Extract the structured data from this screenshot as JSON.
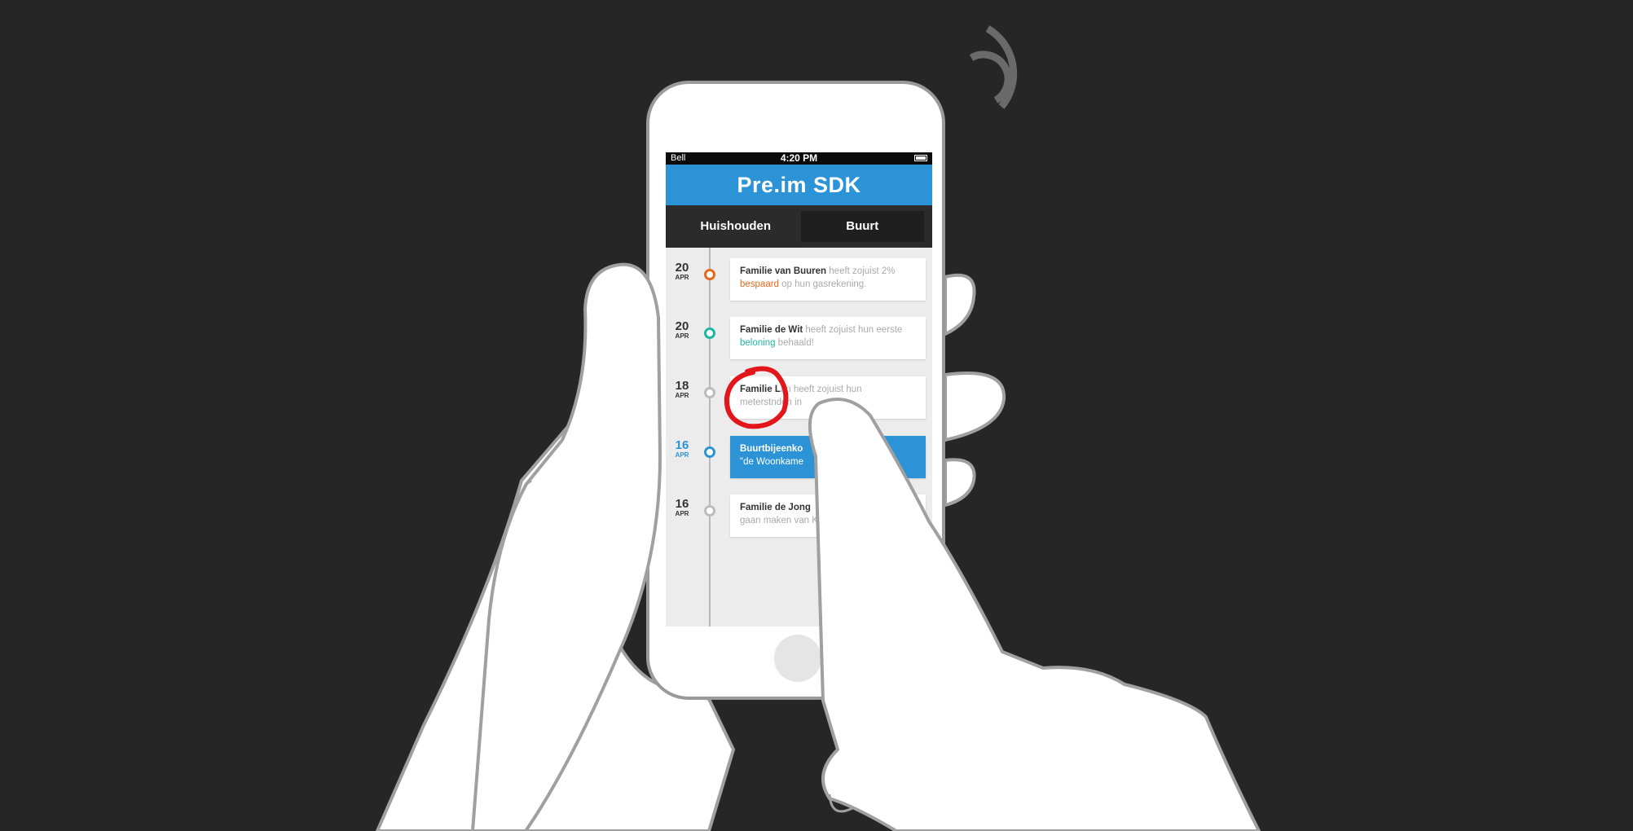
{
  "status_bar": {
    "carrier": "Bell",
    "time": "4:20 PM"
  },
  "app_title": "Pre.im SDK",
  "tabs": [
    {
      "label": "Huishouden",
      "active": false
    },
    {
      "label": "Buurt",
      "active": true
    }
  ],
  "timeline": [
    {
      "day": "20",
      "month": "APR",
      "name": "Familie van Buuren",
      "text1": " heeft zojuist 2% ",
      "highlight": "bespaard",
      "text2": " op hun gasrekening.",
      "dot_color": "#e46a1f",
      "highlight_color": "#e46a1f",
      "style": "normal"
    },
    {
      "day": "20",
      "month": "APR",
      "name": "Familie de Wit",
      "text1": " heeft zojuist hun eerste ",
      "highlight": "beloning",
      "text2": " behaald!",
      "dot_color": "#1fb5a3",
      "highlight_color": "#1fb5a3",
      "style": "normal"
    },
    {
      "day": "18",
      "month": "APR",
      "name": "Familie L",
      "text1": "an heeft zojuist hun meterst",
      "highlight": "",
      "text2": "nden in",
      "dot_color": "#bcbcbc",
      "highlight_color": "",
      "style": "normal"
    },
    {
      "day": "16",
      "month": "APR",
      "name": "Buurtbijeenko",
      "text1": "",
      "highlight": "",
      "text2": "\"de Woonkame",
      "dot_color": "#2b93d6",
      "highlight_color": "",
      "style": "blue"
    },
    {
      "day": "16",
      "month": "APR",
      "name": "Familie de Jong",
      "text1": "",
      "highlight": "",
      "text2": "gaan maken van K",
      "dot_color": "#bcbcbc",
      "highlight_color": "",
      "style": "normal"
    }
  ]
}
